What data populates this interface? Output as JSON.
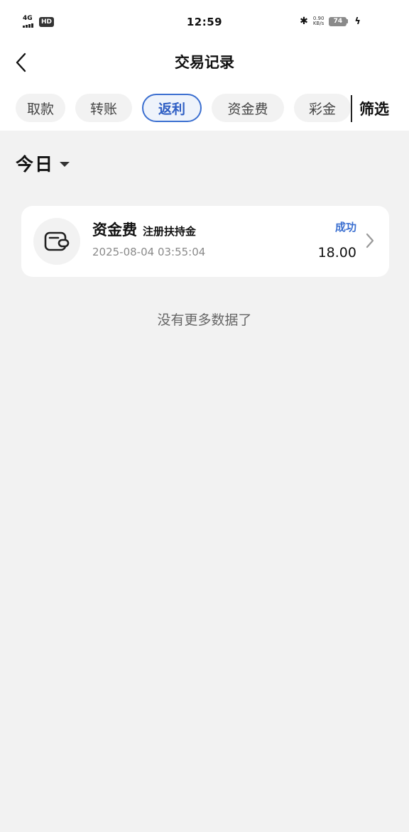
{
  "status_bar": {
    "network": "4G",
    "hd": "HD",
    "time": "12:59",
    "speed_value": "0.90",
    "speed_unit": "KB/s",
    "battery": "74"
  },
  "header": {
    "title": "交易记录"
  },
  "tabs": [
    {
      "label": "取款",
      "active": false
    },
    {
      "label": "转账",
      "active": false
    },
    {
      "label": "返利",
      "active": true
    },
    {
      "label": "资金费",
      "active": false
    },
    {
      "label": "彩金",
      "active": false
    }
  ],
  "filter_label": "筛选",
  "date_filter": {
    "label": "今日"
  },
  "records": [
    {
      "type": "资金费",
      "description": "注册扶持金",
      "time": "2025-08-04 03:55:04",
      "status": "成功",
      "amount": "18.00"
    }
  ],
  "empty_message": "没有更多数据了",
  "colors": {
    "accent": "#3b6fd0",
    "background": "#f2f2f2",
    "card": "#ffffff"
  }
}
